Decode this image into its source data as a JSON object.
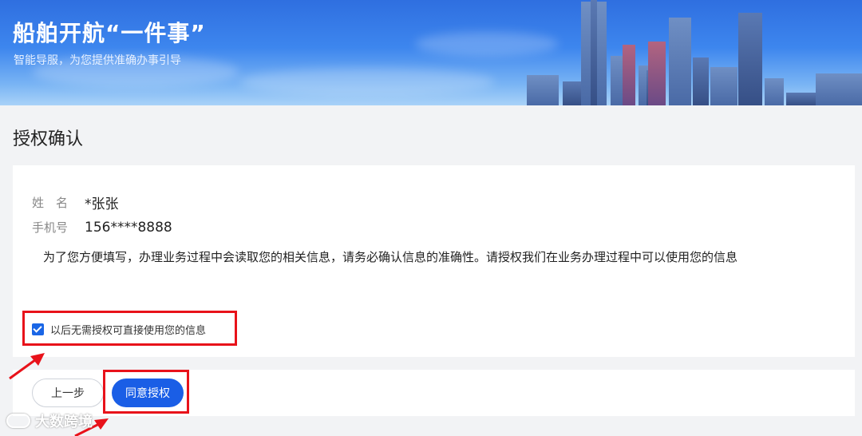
{
  "banner": {
    "title": "船舶开航“一件事”",
    "subtitle": "智能导服，为您提供准确办事引导"
  },
  "page": {
    "section_title": "授权确认"
  },
  "info": {
    "name_label": "姓　名",
    "name_value": "*张张",
    "phone_label": "手机号",
    "phone_value": "156****8888"
  },
  "notice": "为了您方便填写，办理业务过程中会读取您的相关信息，请务必确认信息的准确性。请授权我们在业务办理过程中可以使用您的信息",
  "consent": {
    "label": "以后无需授权可直接使用您的信息",
    "checked": true
  },
  "actions": {
    "prev_label": "上一步",
    "agree_label": "同意授权"
  },
  "watermark": {
    "text": "大数跨境"
  },
  "colors": {
    "primary": "#1a5ee6",
    "highlight": "#e8121a"
  }
}
